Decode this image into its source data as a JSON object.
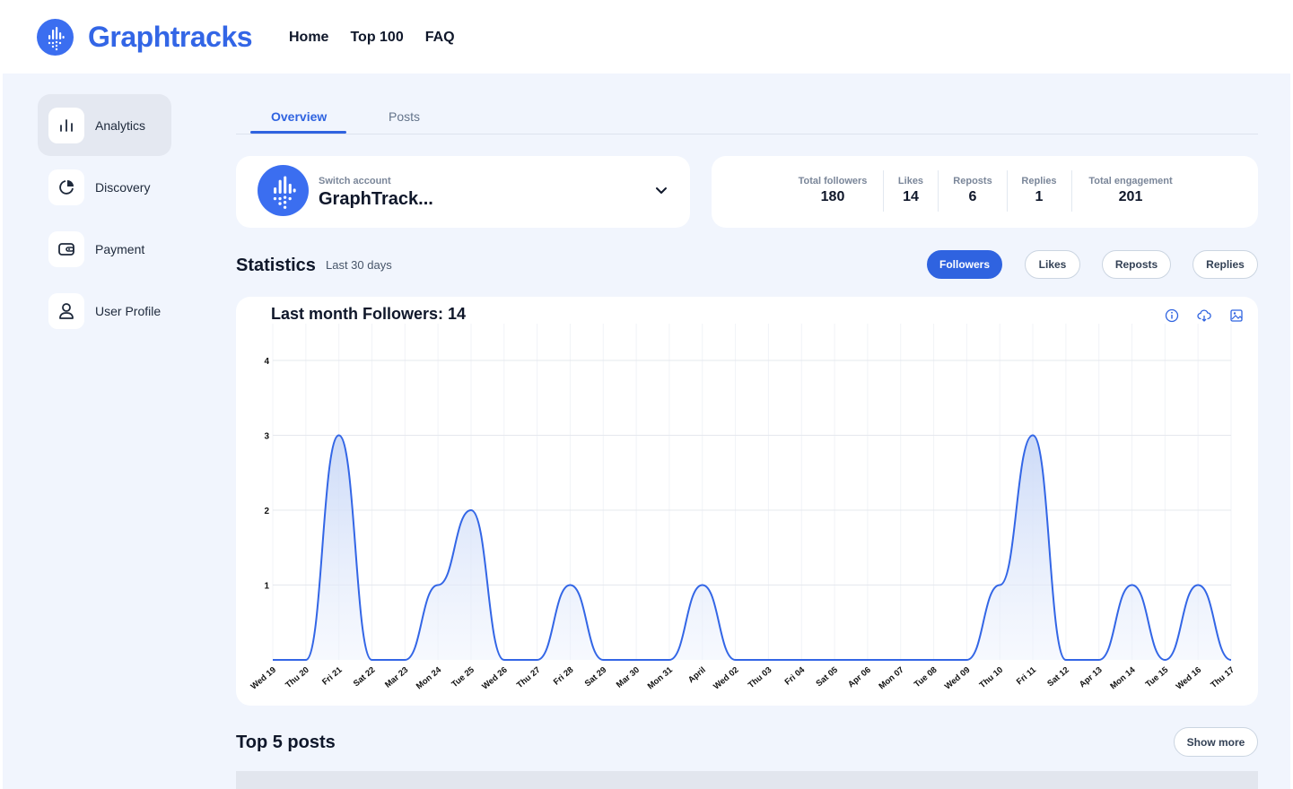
{
  "brand": {
    "name": "Graphtracks",
    "accent": "#2f63e0"
  },
  "nav": {
    "home": "Home",
    "top100": "Top 100",
    "faq": "FAQ"
  },
  "sidebar": {
    "items": [
      {
        "label": "Analytics",
        "icon": "bar-chart-icon",
        "active": true
      },
      {
        "label": "Discovery",
        "icon": "pie-chart-icon",
        "active": false
      },
      {
        "label": "Payment",
        "icon": "wallet-icon",
        "active": false
      },
      {
        "label": "User Profile",
        "icon": "user-icon",
        "active": false
      }
    ]
  },
  "tabs": {
    "overview": "Overview",
    "posts": "Posts"
  },
  "account": {
    "switch_label": "Switch account",
    "name": "GraphTrack..."
  },
  "summary": {
    "total_followers_label": "Total followers",
    "total_followers": "180",
    "likes_label": "Likes",
    "likes": "14",
    "reposts_label": "Reposts",
    "reposts": "6",
    "replies_label": "Replies",
    "replies": "1",
    "total_engagement_label": "Total engagement",
    "total_engagement": "201"
  },
  "statistics": {
    "title": "Statistics",
    "range": "Last 30 days",
    "pills": {
      "followers": "Followers",
      "likes": "Likes",
      "reposts": "Reposts",
      "replies": "Replies"
    }
  },
  "chart_data": {
    "type": "area",
    "title": "Last month Followers: 14",
    "xlabel": "",
    "ylabel": "",
    "ylim": [
      0,
      4
    ],
    "yticks": [
      1,
      2,
      3,
      4
    ],
    "grid": true,
    "legend": "none",
    "color": "#3366e6",
    "x": [
      "Wed 19",
      "Thu 20",
      "Fri 21",
      "Sat 22",
      "Mar 23",
      "Mon 24",
      "Tue 25",
      "Wed 26",
      "Thu 27",
      "Fri 28",
      "Sat 29",
      "Mar 30",
      "Mon 31",
      "April",
      "Wed 02",
      "Thu 03",
      "Fri 04",
      "Sat 05",
      "Apr 06",
      "Mon 07",
      "Tue 08",
      "Wed 09",
      "Thu 10",
      "Fri 11",
      "Sat 12",
      "Apr 13",
      "Mon 14",
      "Tue 15",
      "Wed 16",
      "Thu 17"
    ],
    "values": [
      0,
      0,
      3,
      0,
      0,
      1,
      2,
      0,
      0,
      1,
      0,
      0,
      0,
      1,
      0,
      0,
      0,
      0,
      0,
      0,
      0,
      0,
      1,
      3,
      0,
      0,
      1,
      0,
      1,
      0
    ]
  },
  "top_posts": {
    "title": "Top 5 posts",
    "show_more": "Show more"
  }
}
